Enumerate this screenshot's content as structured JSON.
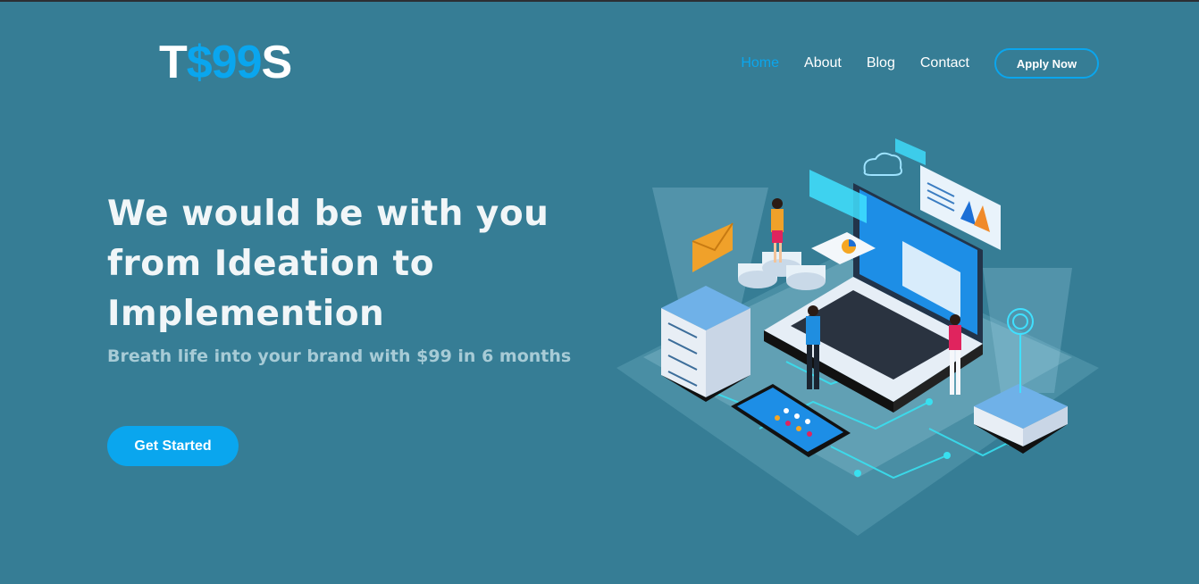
{
  "logo": {
    "part1": "T",
    "part2": "$99",
    "part3": "S"
  },
  "nav": {
    "items": [
      {
        "label": "Home",
        "active": true
      },
      {
        "label": "About",
        "active": false
      },
      {
        "label": "Blog",
        "active": false
      },
      {
        "label": "Contact",
        "active": false
      }
    ],
    "apply_label": "Apply Now"
  },
  "hero": {
    "title_line1": "We would be with you",
    "title_line2": "from Ideation to",
    "title_line3": "Implemention",
    "subtitle": "Breath life into your brand with $99 in 6 months",
    "cta_label": "Get Started"
  },
  "colors": {
    "background": "#367d95",
    "accent": "#0aa6ee",
    "text": "#ffffff",
    "subtitle": "#a7cbd6"
  },
  "illustration": {
    "icons": [
      "server-icon",
      "laptop-icon",
      "smartphone-icon",
      "person-icon",
      "cloud-icon",
      "envelope-icon",
      "chart-icon",
      "wifi-icon"
    ]
  }
}
